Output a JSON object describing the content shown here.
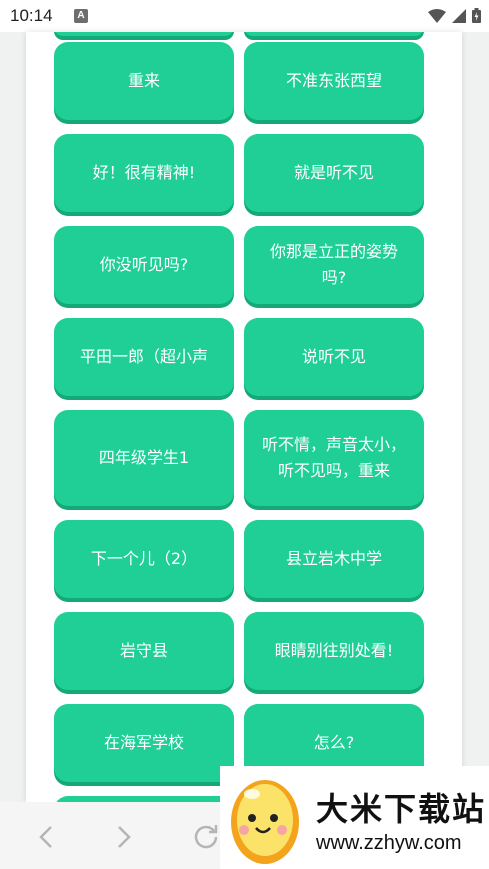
{
  "status_bar": {
    "time": "10:14",
    "notification_icon": "a-letter-icon",
    "icons": [
      "wifi-icon",
      "signal-icon",
      "battery-icon"
    ]
  },
  "buttons": [
    "重来",
    "不准东张西望",
    "好！很有精神!",
    "就是听不见",
    "你没听见吗?",
    "你那是立正的姿势吗?",
    "平田一郎（超小声",
    "说听不见",
    "四年级学生1",
    "听不情，声音太小，听不见吗，重来",
    "下一个儿（2）",
    "县立岩木中学",
    "岩守县",
    "眼睛别往别处看!",
    "在海军学校",
    "怎么?"
  ],
  "nav": {
    "back_icon": "chevron-left-icon",
    "forward_icon": "chevron-right-icon",
    "reload_icon": "reload-icon"
  },
  "watermark": {
    "title": "大米下载站",
    "url": "www.zzhyw.com"
  },
  "colors": {
    "button": "#1fcf96",
    "button_shadow": "#15a878",
    "background": "#e9eaeb"
  }
}
